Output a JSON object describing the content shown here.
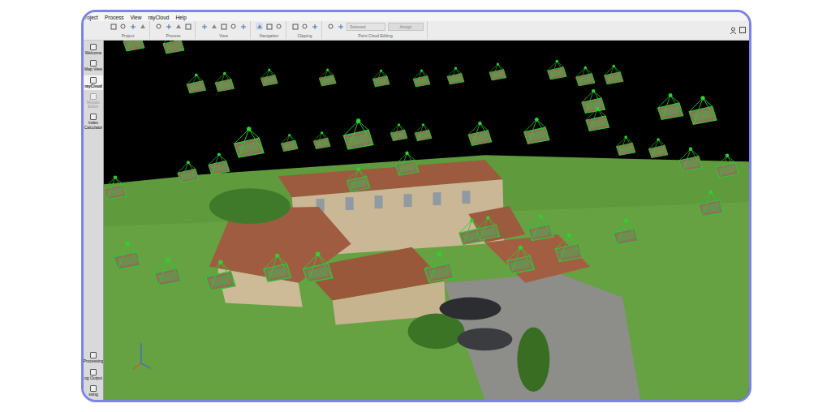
{
  "menu": [
    "roject",
    "Process",
    "View",
    "rayCloud",
    "Help"
  ],
  "toolbar": {
    "groups": [
      {
        "label": "Project"
      },
      {
        "label": "Process"
      },
      {
        "label": "View"
      },
      {
        "label": "Navigation"
      },
      {
        "label": "Clipping"
      },
      {
        "label": "Point Cloud Editing"
      }
    ],
    "dropdown": {
      "value": "Selected"
    },
    "button": "Assign"
  },
  "sidebar": {
    "items": [
      {
        "label": "Welcome",
        "selected": false,
        "disabled": false
      },
      {
        "label": "Map View",
        "selected": false,
        "disabled": false
      },
      {
        "label": "rayCloud",
        "selected": true,
        "disabled": false
      },
      {
        "label": "Mosaic Editor",
        "selected": false,
        "disabled": true
      },
      {
        "label": "Index Calculator",
        "selected": false,
        "disabled": false
      }
    ],
    "bottom": [
      {
        "label": "Processing"
      },
      {
        "label": "og Output"
      },
      {
        "label": "ssing"
      }
    ]
  }
}
